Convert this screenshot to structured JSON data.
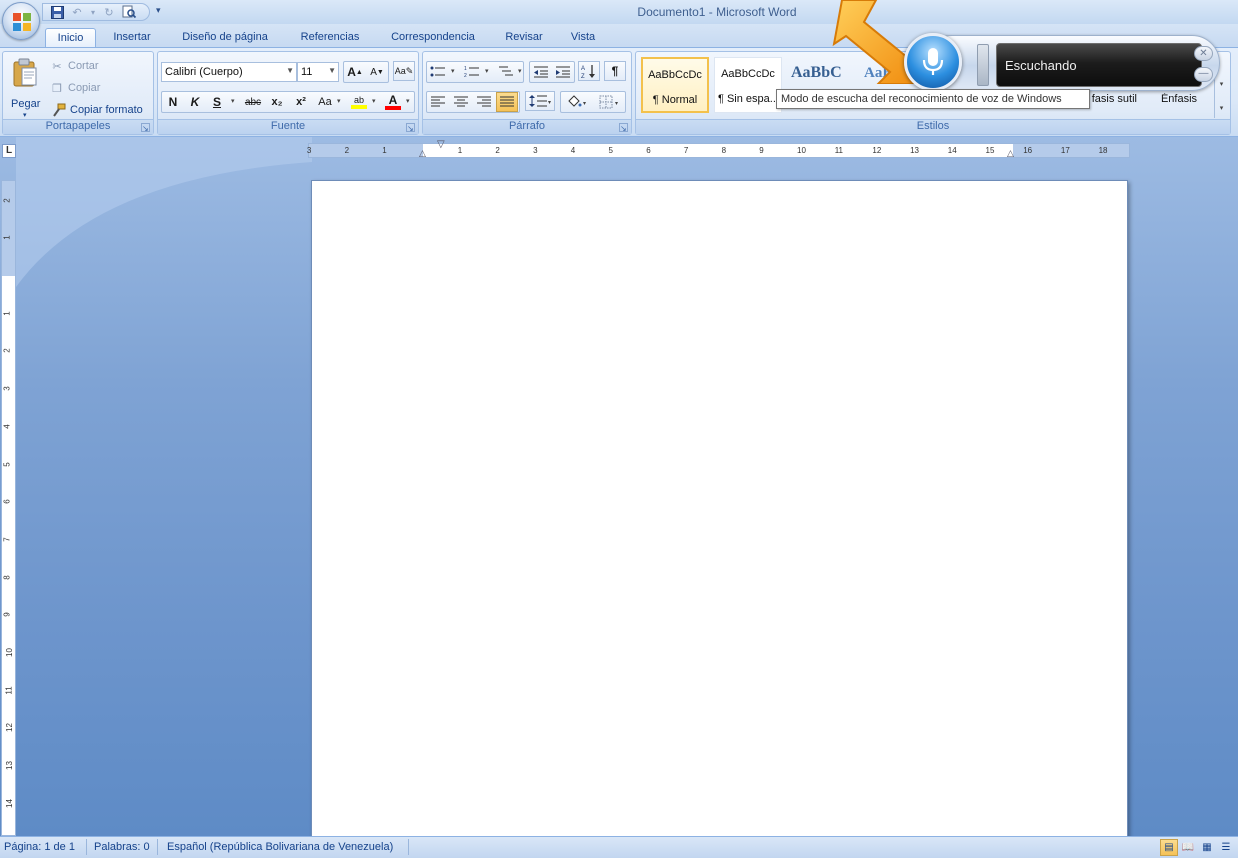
{
  "window": {
    "title": "Documento1 - Microsoft Word"
  },
  "tabs": [
    {
      "id": "inicio",
      "label": "Inicio"
    },
    {
      "id": "insertar",
      "label": "Insertar"
    },
    {
      "id": "diseno",
      "label": "Diseño de página"
    },
    {
      "id": "referencias",
      "label": "Referencias"
    },
    {
      "id": "correspondencia",
      "label": "Correspondencia"
    },
    {
      "id": "revisar",
      "label": "Revisar"
    },
    {
      "id": "vista",
      "label": "Vista"
    }
  ],
  "clipboard": {
    "label": "Portapapeles",
    "paste": "Pegar",
    "cut": "Cortar",
    "copy": "Copiar",
    "format_painter": "Copiar formato"
  },
  "font": {
    "label": "Fuente",
    "name": "Calibri (Cuerpo)",
    "size": "11",
    "bold": "N",
    "italic": "K",
    "underline": "S",
    "strike": "abc",
    "subscript": "x₂",
    "superscript": "x²",
    "case": "Aa",
    "highlight": "ab",
    "color": "A",
    "grow": "A",
    "shrink": "A"
  },
  "paragraph": {
    "label": "Párrafo",
    "pilcrow": "¶"
  },
  "styles": {
    "label": "Estilos",
    "items": [
      {
        "sample": "AaBbCcDc",
        "name": "¶ Normal"
      },
      {
        "sample": "AaBbCcDc",
        "name": "¶ Sin espa..."
      },
      {
        "sample": "AaBbC",
        "name": ""
      },
      {
        "sample": "AaBb",
        "name": ""
      },
      {
        "sample": "",
        "name": "fasis sutil"
      },
      {
        "sample": "",
        "name": "Énfasis"
      }
    ]
  },
  "speech": {
    "status": "Escuchando",
    "tooltip": "Modo de escucha del reconocimiento de voz de Windows"
  },
  "ruler": {
    "h_ticks": [
      "3",
      "2",
      "1",
      "1",
      "2",
      "3",
      "4",
      "5",
      "6",
      "7",
      "8",
      "9",
      "10",
      "11",
      "12",
      "13",
      "14",
      "15",
      "16",
      "17",
      "18"
    ],
    "v_ticks": [
      "2",
      "1",
      "1",
      "2",
      "3",
      "4",
      "5",
      "6",
      "7",
      "8",
      "9",
      "10",
      "11",
      "12",
      "13",
      "14"
    ]
  },
  "status_bar": {
    "page": "Página: 1 de 1",
    "words": "Palabras: 0",
    "language": "Español (República Bolivariana de Venezuela)"
  },
  "colors": {
    "accent": "#15428b",
    "highlight": "#ffff00",
    "font_color": "#ff0000",
    "arrow": "#f7a01a"
  }
}
